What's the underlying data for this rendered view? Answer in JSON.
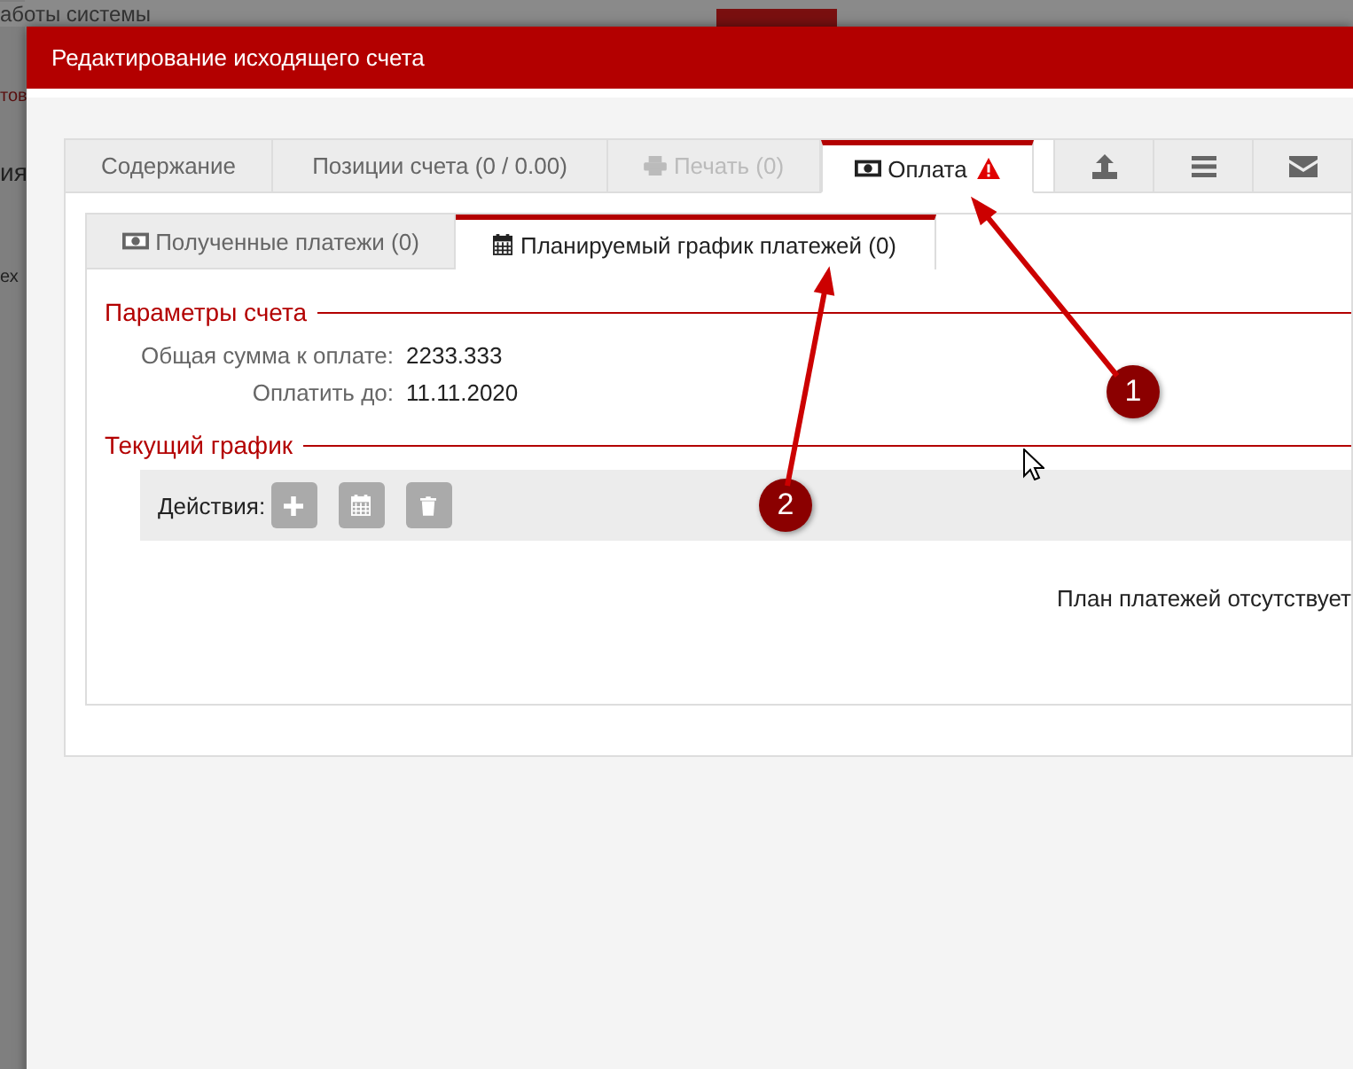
{
  "background": {
    "fragments": [
      "аботы системы",
      "тов",
      "ия",
      "ех"
    ]
  },
  "dialog": {
    "title": "Редактирование исходящего счета",
    "tabs": [
      {
        "label": "Содержание",
        "kind": "plain",
        "selected": false,
        "disabled": false,
        "warning": false
      },
      {
        "label": "Позиции счета (0 / 0.00)",
        "kind": "plain",
        "selected": false,
        "disabled": false,
        "warning": false
      },
      {
        "label": "Печать (0)",
        "kind": "printer",
        "selected": false,
        "disabled": true,
        "warning": false
      },
      {
        "label": "Оплата",
        "kind": "money",
        "selected": true,
        "disabled": false,
        "warning": true
      }
    ],
    "tool_tabs": [
      {
        "kind": "upload"
      },
      {
        "kind": "menu"
      },
      {
        "kind": "mail"
      }
    ],
    "subtabs": [
      {
        "label": "Полученные платежи (0)",
        "kind": "money",
        "selected": false
      },
      {
        "label": "Планируемый график платежей (0)",
        "kind": "calendar",
        "selected": true
      }
    ],
    "sections": [
      {
        "title": "Параметры счета",
        "fields": [
          {
            "label": "Общая сумма к оплате:",
            "value": "2233.333"
          },
          {
            "label": "Оплатить до:",
            "value": "11.11.2020"
          }
        ]
      },
      {
        "title": "Текущий график",
        "actions": {
          "label": "Действия:",
          "buttons": [
            {
              "kind": "add"
            },
            {
              "kind": "calendar"
            },
            {
              "kind": "delete"
            }
          ]
        },
        "empty_text": "План платежей отсутствует"
      }
    ]
  },
  "callouts": [
    {
      "label": "1"
    },
    {
      "label": "2"
    }
  ]
}
